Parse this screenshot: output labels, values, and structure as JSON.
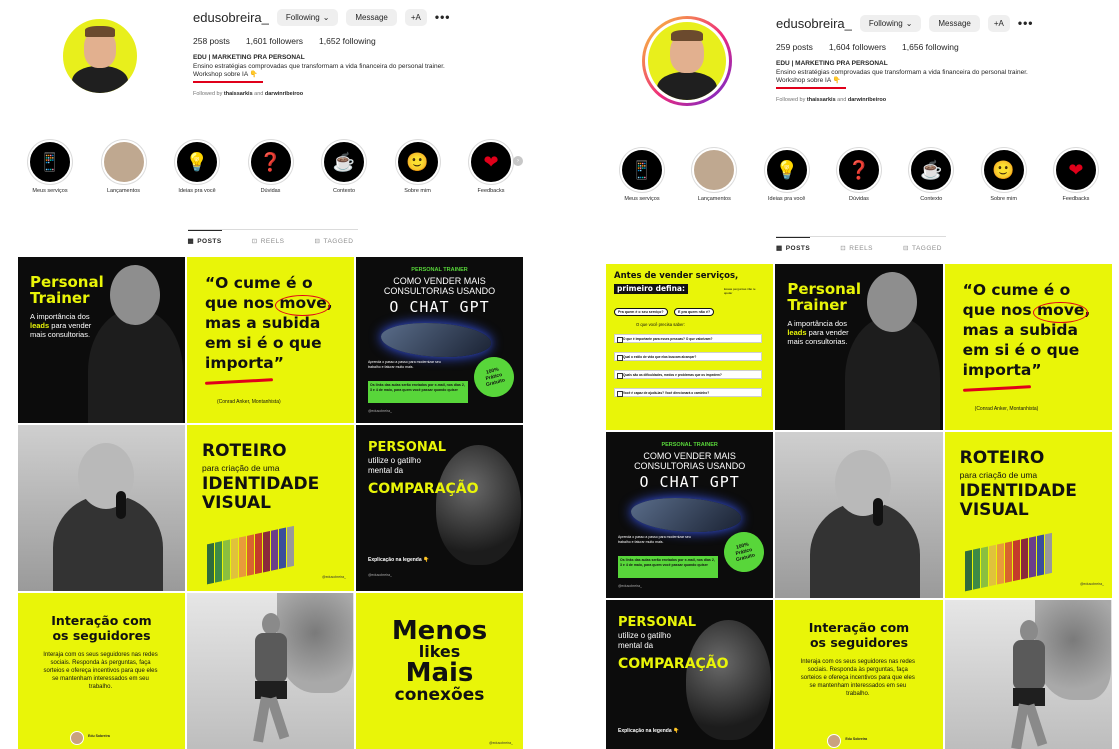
{
  "colors": {
    "accent_yellow": "#e9f508",
    "underline_red": "#e0001a",
    "ig_button": "#efefef",
    "muted_text": "#737373"
  },
  "left": {
    "profile": {
      "username": "edusobreira_",
      "following_btn": "Following",
      "message_btn": "Message",
      "add_user_btn": "+A",
      "more": "•••",
      "posts": "258 posts",
      "followers": "1,601 followers",
      "following": "1,652 following",
      "bio_name": "EDU | MARKETING PRA PERSONAL",
      "bio_line1": "Ensino estratégias comprovadas que transformam a vida financeira do personal trainer.",
      "bio_line2": "Workshop sobre IA 👇",
      "followed_prefix": "Followed by",
      "followed_names": "thaissarkis",
      "followed_and": "and",
      "followed_names2": "darwinribeiroo"
    }
  },
  "right": {
    "profile": {
      "username": "edusobreira_",
      "following_btn": "Following",
      "message_btn": "Message",
      "add_user_btn": "+A",
      "more": "•••",
      "posts": "259 posts",
      "followers": "1,604 followers",
      "following": "1,656 following",
      "bio_name": "EDU | MARKETING PRA PERSONAL",
      "bio_line1": "Ensino estratégias comprovadas que transformam a vida financeira do personal trainer.",
      "bio_line2": "Workshop sobre IA 👇",
      "followed_prefix": "Followed by",
      "followed_names": "thaissarkis",
      "followed_and": "and",
      "followed_names2": "darwinribeiroo"
    }
  },
  "highlights": [
    {
      "label": "Meus serviços",
      "icon": "phone-icon",
      "glyph": "📱"
    },
    {
      "label": "Lançamentos",
      "icon": "photo-thumbnail",
      "glyph": ""
    },
    {
      "label": "Ideias pra você",
      "icon": "lightbulb-icon",
      "glyph": "💡"
    },
    {
      "label": "Dúvidas",
      "icon": "chat-question-icon",
      "glyph": "❓"
    },
    {
      "label": "Contexto",
      "icon": "coffee-cup-icon",
      "glyph": "☕"
    },
    {
      "label": "Sobre mim",
      "icon": "avatar-3d-icon",
      "glyph": "🙂"
    },
    {
      "label": "Feedbacks",
      "icon": "heart-chat-icon",
      "glyph": "❤"
    }
  ],
  "tabs": [
    {
      "label": "POSTS",
      "icon": "grid-icon",
      "glyph": "▦",
      "active": true
    },
    {
      "label": "REELS",
      "icon": "reels-icon",
      "glyph": "⊡",
      "active": false
    },
    {
      "label": "TAGGED",
      "icon": "tag-icon",
      "glyph": "⊟",
      "active": false
    }
  ],
  "posts": {
    "personal_trainer": {
      "title1": "Personal",
      "title2": "Trainer",
      "body_pre": "A importância dos",
      "body_bold": "leads",
      "body_post": "para vender mais consultorias."
    },
    "quote": {
      "l1": "“O cume é o",
      "l2a": "que nos",
      "l2b": "move",
      "l3": "mas a subida",
      "l4": "em si é o que",
      "l5": "importa”",
      "author": "(Conrad Anker, Montanhista)"
    },
    "chatgpt": {
      "kicker": "PERSONAL TRAINER",
      "l1": "COMO VENDER MAIS",
      "l2": "CONSULTORIAS USANDO",
      "l3": "O CHAT GPT",
      "small": "Aprenda o passo a passo para modernizar seu trabalho e faturar muito mais.",
      "badge1": "100%",
      "badge2": "Prático",
      "badge3": "Gratuito",
      "green": "Os links das aulas serão enviados por e-mail, nos dias 2, 3 e 4 de maio, para quem você passar quando quiser",
      "handle": "@edusobreira_"
    },
    "roteiro": {
      "l1": "ROTEIRO",
      "l2": "para criação de uma",
      "l3": "IDENTIDADE",
      "l4": "VISUAL",
      "handle": "@edusobreira_"
    },
    "comparacao": {
      "l1": "PERSONAL",
      "l2": "utilize o gatilho",
      "l3": "mental da",
      "l4": "COMPARAÇÃO",
      "foot": "Explicação na legenda 👇",
      "handle": "@edusobreira_"
    },
    "interacao": {
      "l1": "Interação com",
      "l2": "os seguidores",
      "body": "Interaja com os seus seguidores nas redes sociais. Responda às perguntas, faça sorteios e ofereça incentivos para que eles se mantenham interessados em seu trabalho.",
      "sig": "Edu Sobreira"
    },
    "menos": {
      "l1": "Menos",
      "l2": "likes",
      "l3": "Mais",
      "l4": "conexões",
      "handle": "@edusobreira_"
    },
    "vender": {
      "t1": "Antes de vender serviços,",
      "t2": "primeiro defina:",
      "note": "Essas perguntas irão te ajudar",
      "pill1": "Pra quem é o seu serviço?",
      "pill2": "E pra quem não é?",
      "mid": "O que você precisa saber:",
      "q1": "O que é importante para esses pessoas? O que valorizam?",
      "q2": "Qual o estilo de vida que elas buscam alcançar?",
      "q3": "Quais são as dificuldades, medos e problemas que os impedem?",
      "q4": "Você é capaz de ajudá-las? Você direcionará o caminho?"
    }
  }
}
